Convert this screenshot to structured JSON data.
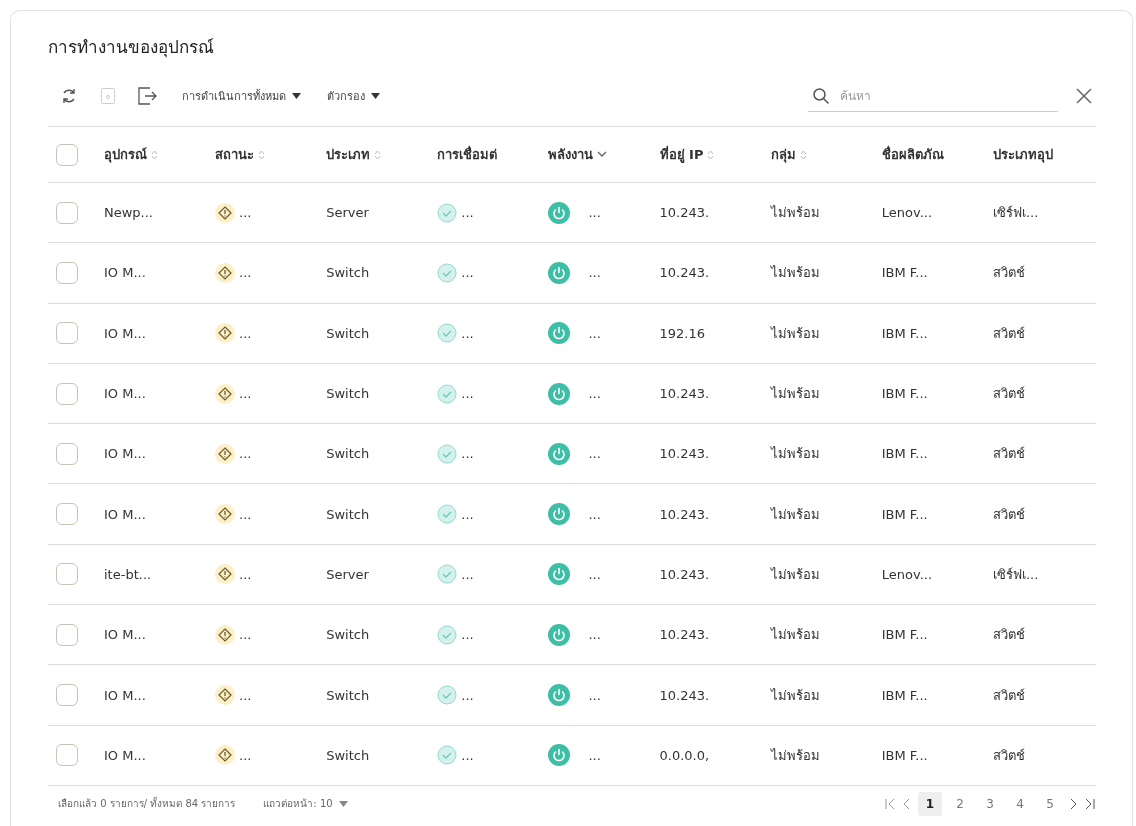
{
  "title": "การทำงานของอุปกรณ์",
  "toolbar": {
    "actions_menu": "การดำเนินการทั้งหมด",
    "filter_menu": "ตัวกรอง",
    "search": {
      "placeholder": "ค้นหา"
    }
  },
  "table": {
    "select_all": {
      "checked": false
    },
    "columns": [
      {
        "label": "อุปกรณ์",
        "sortable": true,
        "sorted": false
      },
      {
        "label": "สถานะ",
        "sortable": true,
        "sorted": false
      },
      {
        "label": "ประเภท",
        "sortable": true,
        "sorted": false
      },
      {
        "label": "การเชื่อมต่",
        "sortable": false
      },
      {
        "label": "พลังงาน",
        "sortable": true,
        "sorted": true
      },
      {
        "label": "ที่อยู่ IP",
        "sortable": true,
        "sorted": false
      },
      {
        "label": "กลุ่ม",
        "sortable": true,
        "sorted": false
      },
      {
        "label": "ชื่อผลิตภัณ",
        "sortable": false
      },
      {
        "label": "ประเภทอุป",
        "sortable": false
      }
    ],
    "rows": [
      {
        "checked": false,
        "device": "Newp...",
        "warning": true,
        "status_text": "...",
        "type": "Server",
        "connected": true,
        "connection_text": "...",
        "powered_on": true,
        "power_text": "...",
        "ip": "10.243.",
        "group": "ไม่พร้อม",
        "product": "Lenov...",
        "device_type": "เซิร์ฟเ..."
      },
      {
        "checked": false,
        "device": "IO M...",
        "warning": true,
        "status_text": "...",
        "type": "Switch",
        "connected": true,
        "connection_text": "...",
        "powered_on": true,
        "power_text": "...",
        "ip": "10.243.",
        "group": "ไม่พร้อม",
        "product": "IBM F...",
        "device_type": "สวิตช์"
      },
      {
        "checked": false,
        "device": "IO M...",
        "warning": true,
        "status_text": "...",
        "type": "Switch",
        "connected": true,
        "connection_text": "...",
        "powered_on": true,
        "power_text": "...",
        "ip": "192.16",
        "group": "ไม่พร้อม",
        "product": "IBM F...",
        "device_type": "สวิตช์"
      },
      {
        "checked": false,
        "device": "IO M...",
        "warning": true,
        "status_text": "...",
        "type": "Switch",
        "connected": true,
        "connection_text": "...",
        "powered_on": true,
        "power_text": "...",
        "ip": "10.243.",
        "group": "ไม่พร้อม",
        "product": "IBM F...",
        "device_type": "สวิตช์"
      },
      {
        "checked": false,
        "device": "IO M...",
        "warning": true,
        "status_text": "...",
        "type": "Switch",
        "connected": true,
        "connection_text": "...",
        "powered_on": true,
        "power_text": "...",
        "ip": "10.243.",
        "group": "ไม่พร้อม",
        "product": "IBM F...",
        "device_type": "สวิตช์"
      },
      {
        "checked": false,
        "device": "IO M...",
        "warning": true,
        "status_text": "...",
        "type": "Switch",
        "connected": true,
        "connection_text": "...",
        "powered_on": true,
        "power_text": "...",
        "ip": "10.243.",
        "group": "ไม่พร้อม",
        "product": "IBM F...",
        "device_type": "สวิตช์"
      },
      {
        "checked": false,
        "device": "ite-bt...",
        "warning": true,
        "status_text": "...",
        "type": "Server",
        "connected": true,
        "connection_text": "...",
        "powered_on": true,
        "power_text": "...",
        "ip": "10.243.",
        "group": "ไม่พร้อม",
        "product": "Lenov...",
        "device_type": "เซิร์ฟเ..."
      },
      {
        "checked": false,
        "device": "IO M...",
        "warning": true,
        "status_text": "...",
        "type": "Switch",
        "connected": true,
        "connection_text": "...",
        "powered_on": true,
        "power_text": "...",
        "ip": "10.243.",
        "group": "ไม่พร้อม",
        "product": "IBM F...",
        "device_type": "สวิตช์"
      },
      {
        "checked": false,
        "device": "IO M...",
        "warning": true,
        "status_text": "...",
        "type": "Switch",
        "connected": true,
        "connection_text": "...",
        "powered_on": true,
        "power_text": "...",
        "ip": "10.243.",
        "group": "ไม่พร้อม",
        "product": "IBM F...",
        "device_type": "สวิตช์"
      },
      {
        "checked": false,
        "device": "IO M...",
        "warning": true,
        "status_text": "...",
        "type": "Switch",
        "connected": true,
        "connection_text": "...",
        "powered_on": true,
        "power_text": "...",
        "ip": "0.0.0.0,",
        "group": "ไม่พร้อม",
        "product": "IBM F...",
        "device_type": "สวิตช์"
      }
    ]
  },
  "footer": {
    "selection": "เลือกแล้ว 0 รายการ/ ทั้งหมด 84 รายการ",
    "rows_per_page": "แถวต่อหน้า: 10",
    "pages": [
      {
        "label": "1",
        "selected": true
      },
      {
        "label": "2",
        "selected": false
      },
      {
        "label": "3",
        "selected": false
      },
      {
        "label": "4",
        "selected": false
      },
      {
        "label": "5",
        "selected": false
      }
    ]
  }
}
